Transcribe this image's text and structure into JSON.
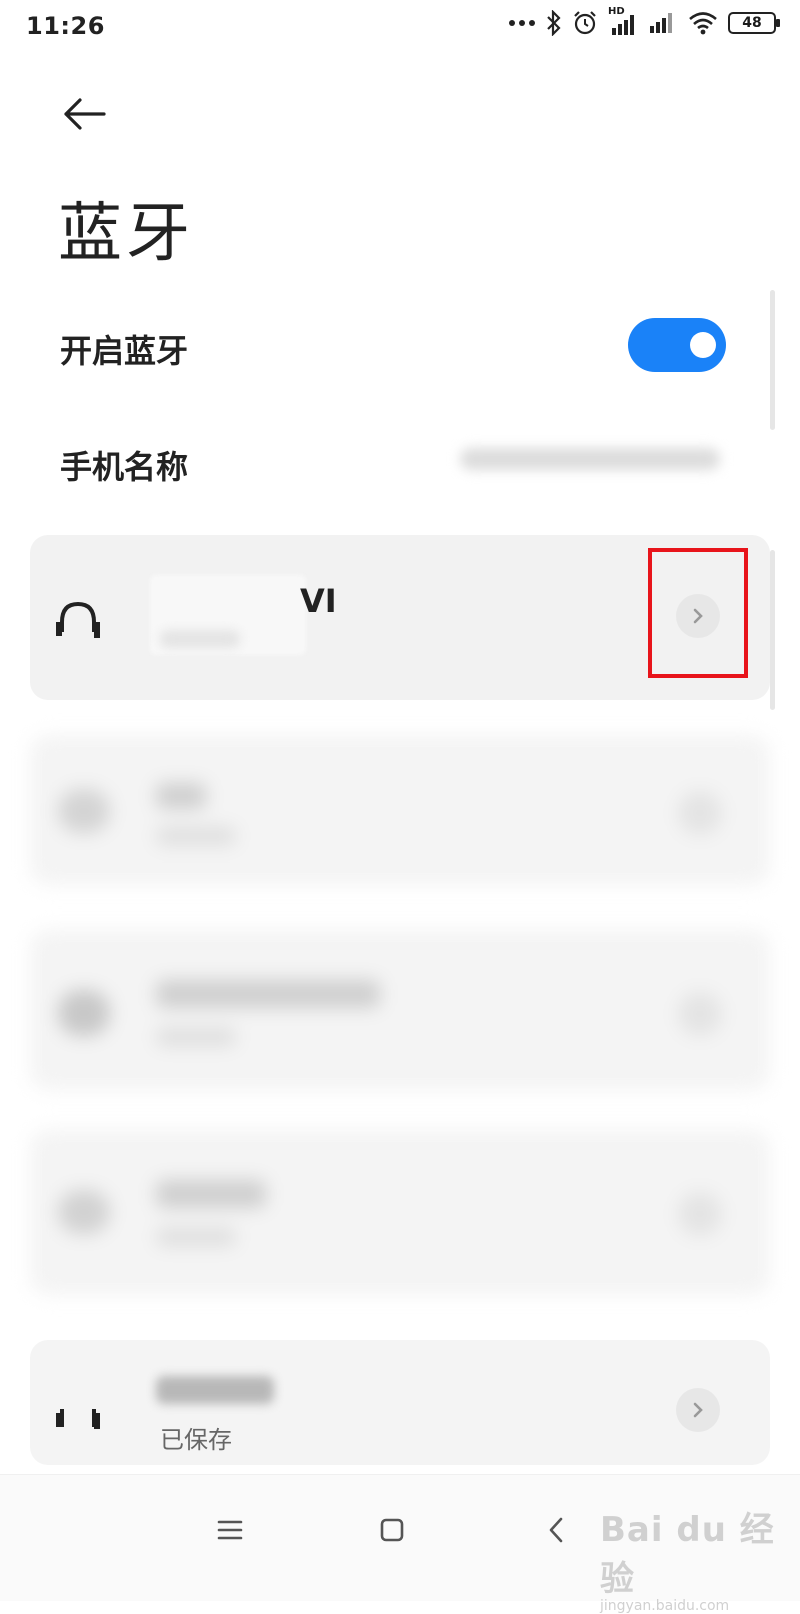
{
  "status_bar": {
    "time": "11:26",
    "icons": [
      "more-icon",
      "bluetooth-icon",
      "alarm-icon",
      "hd-signal-icon",
      "signal-icon",
      "wifi-icon",
      "battery-icon"
    ],
    "hd_label": "HD",
    "battery_level": "48"
  },
  "header": {
    "back_icon": "back-arrow-icon",
    "title": "蓝牙"
  },
  "settings": {
    "bluetooth_toggle": {
      "label": "开启蓝牙",
      "on": true,
      "color": "#1a82f8"
    },
    "device_name": {
      "label": "手机名称"
    }
  },
  "devices": [
    {
      "icon": "headphones-icon",
      "name_visible": "VI",
      "obscured": true,
      "highlighted_detail_button": true
    },
    {
      "icon": "device-icon",
      "obscured": true
    },
    {
      "icon": "device-icon",
      "obscured": true
    },
    {
      "icon": "device-icon",
      "obscured": true
    },
    {
      "icon": "headphones-icon",
      "status": "已保存",
      "obscured": true
    }
  ],
  "highlight": {
    "color": "#e8141b"
  },
  "nav_bar": {
    "buttons": [
      "menu-icon",
      "home-icon",
      "back-icon"
    ]
  },
  "watermark": {
    "logo": "Bai du 经验",
    "url": "jingyan.baidu.com"
  }
}
